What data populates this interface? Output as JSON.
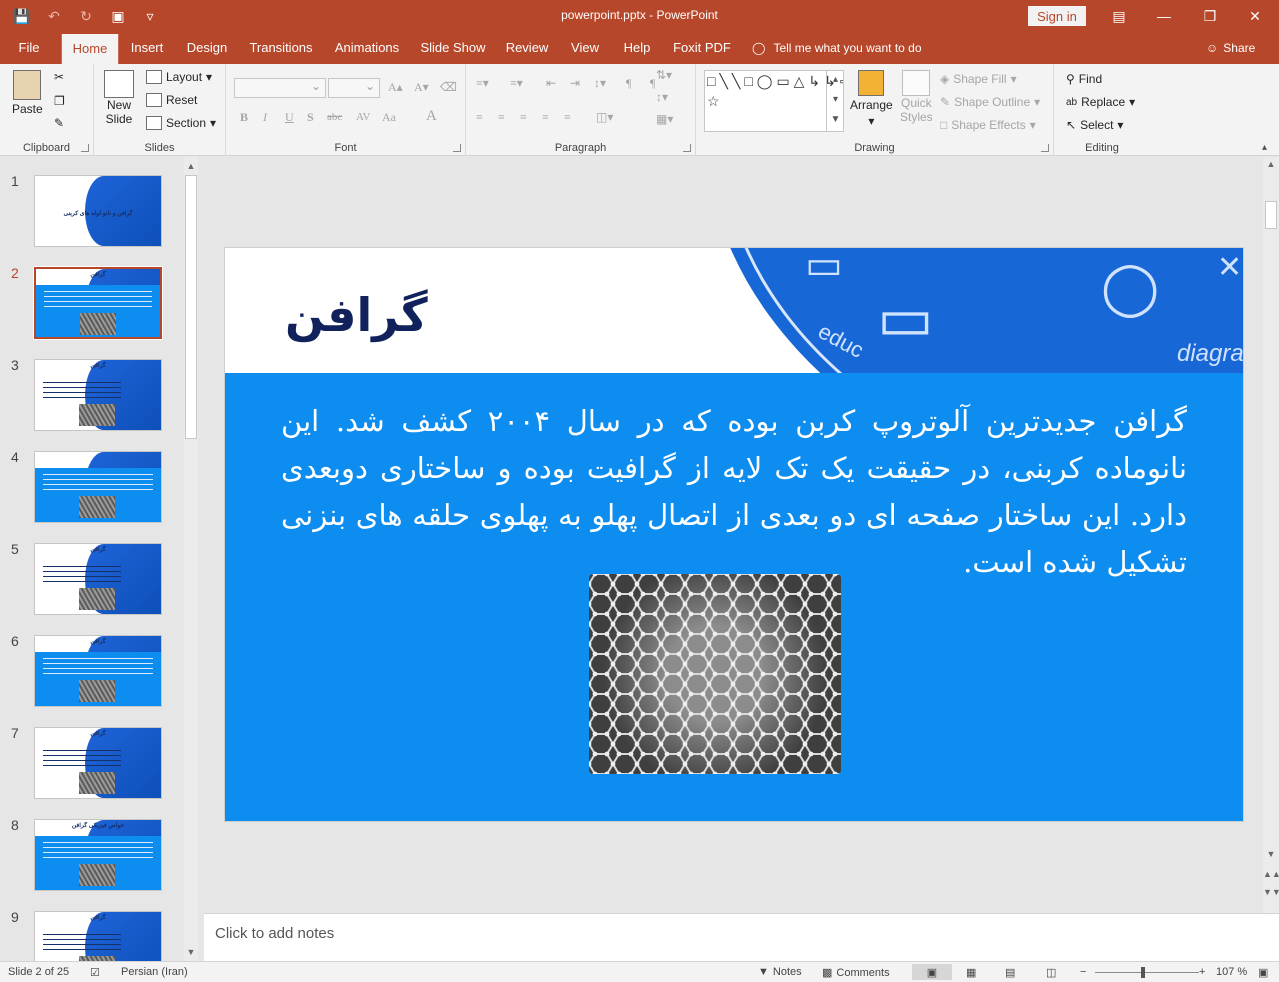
{
  "window": {
    "title": "powerpoint.pptx  -  PowerPoint",
    "signin_label": "Sign in"
  },
  "tabs": [
    "File",
    "Home",
    "Insert",
    "Design",
    "Transitions",
    "Animations",
    "Slide Show",
    "Review",
    "View",
    "Help",
    "Foxit PDF"
  ],
  "active_tab": "Home",
  "tellme": "Tell me what you want to do",
  "share": "Share",
  "ribbon": {
    "clipboard": {
      "label": "Clipboard",
      "paste": "Paste"
    },
    "slides": {
      "label": "Slides",
      "new_slide": "New",
      "new_slide2": "Slide",
      "layout": "Layout",
      "reset": "Reset",
      "section": "Section"
    },
    "font": {
      "label": "Font",
      "bold": "B",
      "italic": "I",
      "underline": "U",
      "strike": "S",
      "shadow": "abc",
      "spacing": "AV",
      "case": "Aa",
      "color": "A"
    },
    "paragraph": {
      "label": "Paragraph"
    },
    "drawing": {
      "label": "Drawing",
      "arrange": "Arrange",
      "quick_styles": "Quick",
      "quick_styles2": "Styles",
      "shape_fill": "Shape Fill",
      "shape_outline": "Shape Outline",
      "shape_effects": "Shape Effects"
    },
    "editing": {
      "label": "Editing",
      "find": "Find",
      "replace": "Replace",
      "select": "Select"
    }
  },
  "thumbnails": [
    {
      "num": "1",
      "title": "گرافن و نانو لوله های کربنی"
    },
    {
      "num": "2",
      "title": "گرافن"
    },
    {
      "num": "3",
      "title": "گرافن"
    },
    {
      "num": "4",
      "title": ""
    },
    {
      "num": "5",
      "title": "گرافن"
    },
    {
      "num": "6",
      "title": "گرافن"
    },
    {
      "num": "7",
      "title": "گرافن"
    },
    {
      "num": "8",
      "title": "خواص فیزیکی گرافن"
    },
    {
      "num": "9",
      "title": "گرافن"
    }
  ],
  "selected_slide": "2",
  "slide": {
    "title": "گرافن",
    "body": "گرافن جدیدترین آلوتروپ کربن بوده که در سال ۲۰۰۴ کشف شد. این نانوماده کربنی، در حقیقت یک تک لایه از گرافیت بوده و ساختاری دوبعدی دارد. این ساختار صفحه ای دو بعدی از اتصال پهلو به پهلوی حلقه های بنزنی تشکیل شده است.",
    "doodle1": "educ",
    "doodle2": "diagra"
  },
  "notes_placeholder": "Click to add notes",
  "status": {
    "slide_counter": "Slide 2 of 25",
    "language": "Persian (Iran)",
    "notes": "Notes",
    "comments": "Comments",
    "zoom": "107 %",
    "zoom_minus": "−",
    "zoom_plus": "+"
  }
}
